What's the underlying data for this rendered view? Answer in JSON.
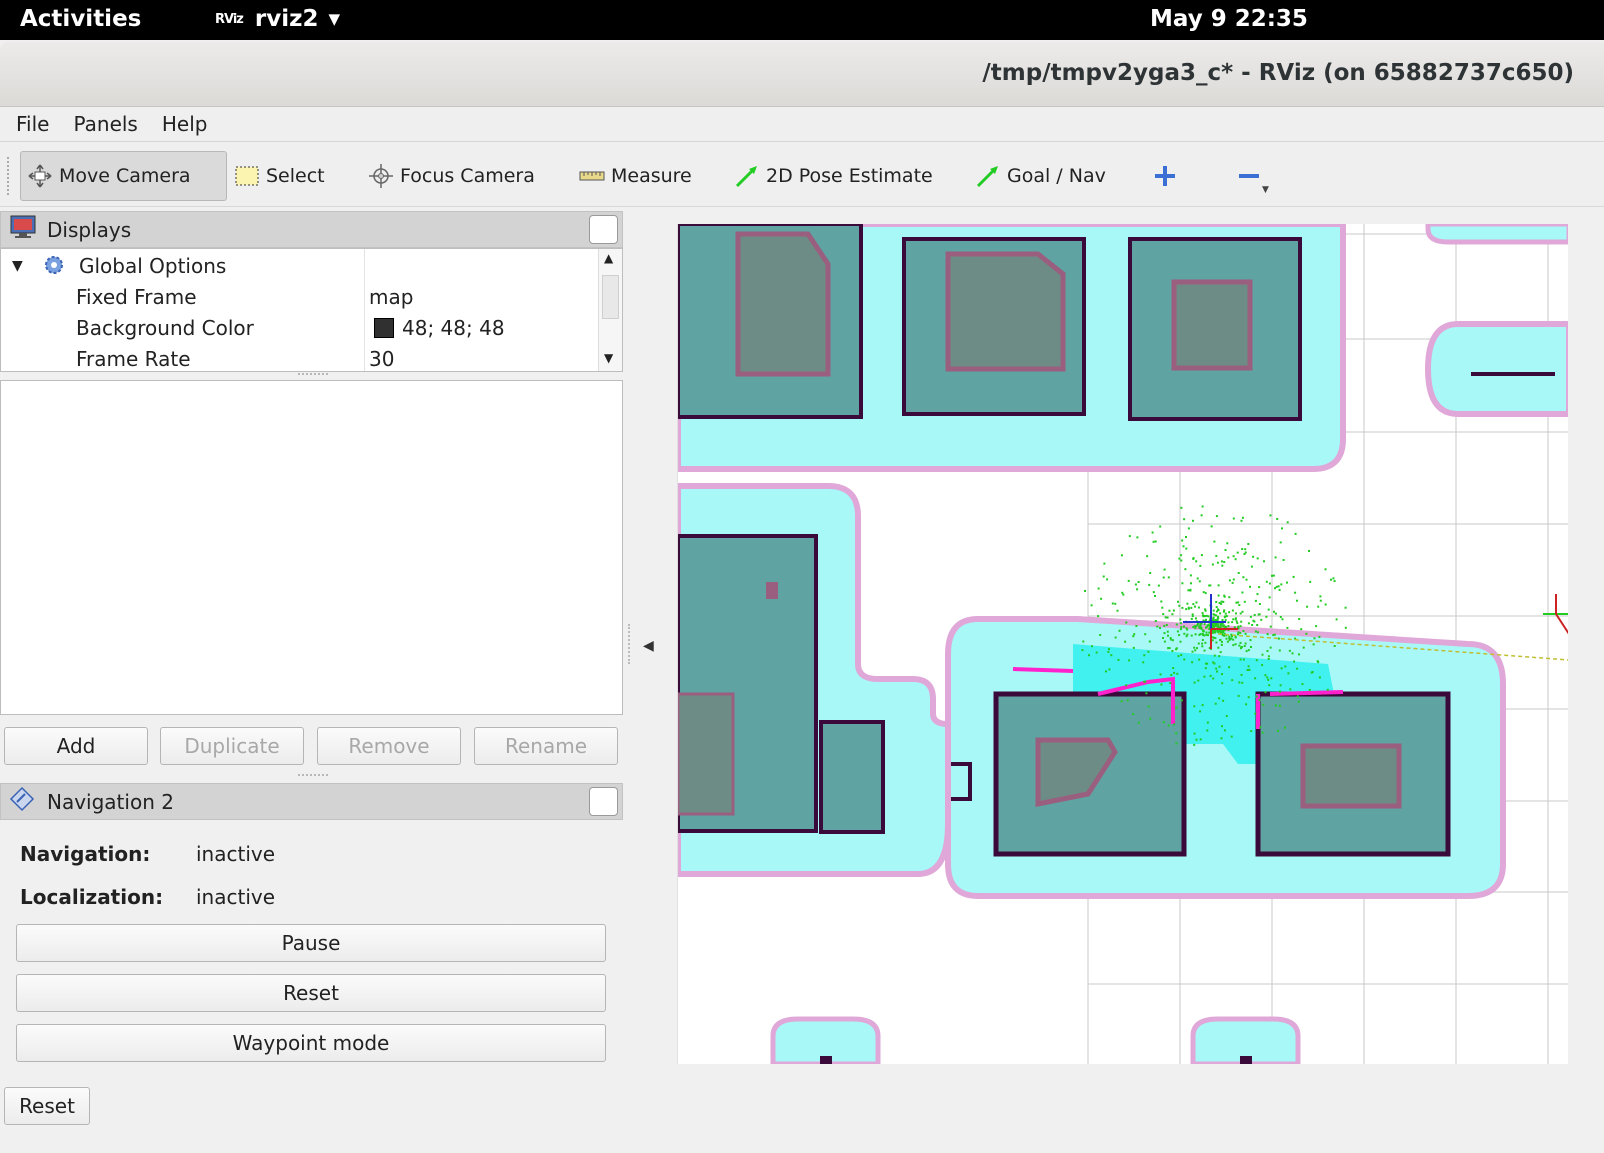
{
  "topbar": {
    "activities": "Activities",
    "app_badge": "RViz",
    "app_name": "rviz2",
    "clock": "May 9  22:35"
  },
  "window": {
    "title": "/tmp/tmpv2yga3_c* - RViz (on 65882737c650)"
  },
  "menu": {
    "file": "File",
    "panels": "Panels",
    "help": "Help"
  },
  "toolbar": {
    "move_camera": "Move Camera",
    "select": "Select",
    "focus_camera": "Focus Camera",
    "measure": "Measure",
    "pose_estimate": "2D Pose Estimate",
    "goal_nav": "Goal / Nav",
    "add_tool_icon": "plus-icon",
    "remove_tool_icon": "minus-icon"
  },
  "displays": {
    "header": "Displays",
    "tree": {
      "global_options": "Global Options",
      "fixed_frame_label": "Fixed Frame",
      "fixed_frame_value": "map",
      "bg_color_label": "Background Color",
      "bg_color_value": "48; 48; 48",
      "bg_color_swatch": "#303030",
      "frame_rate_label": "Frame Rate",
      "frame_rate_value": "30"
    },
    "buttons": {
      "add": "Add",
      "duplicate": "Duplicate",
      "remove": "Remove",
      "rename": "Rename"
    }
  },
  "navigation": {
    "header": "Navigation 2",
    "navigation_label": "Navigation:",
    "navigation_value": "inactive",
    "localization_label": "Localization:",
    "localization_value": "inactive",
    "pause": "Pause",
    "reset": "Reset",
    "waypoint_mode": "Waypoint mode"
  },
  "footer": {
    "reset": "Reset"
  },
  "colors": {
    "inflation_cyan": "#a8f8f8",
    "inflation_border": "#e0a8d8",
    "obstacle_fill": "#5fa3a3",
    "lethal": "#3a0b3a",
    "inner_magenta": "#9a5e7e",
    "laser_magenta": "#ff22cc",
    "particles_green": "#22cc22"
  }
}
